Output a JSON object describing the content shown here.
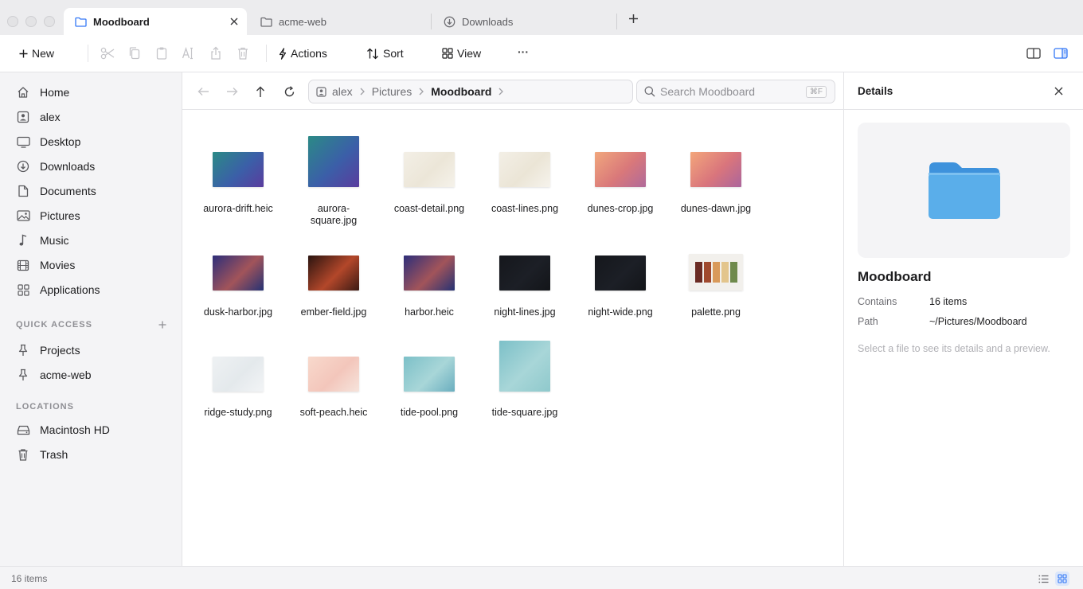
{
  "tabs": [
    {
      "label": "Moodboard",
      "icon": "folder-icon",
      "active": true
    },
    {
      "label": "acme-web",
      "icon": "folder-icon",
      "active": false
    },
    {
      "label": "Downloads",
      "icon": "download-icon",
      "active": false
    }
  ],
  "toolbar": {
    "new_label": "New",
    "actions_label": "Actions",
    "sort_label": "Sort",
    "view_label": "View",
    "more_label": "···"
  },
  "sidebar": {
    "favorites": [
      {
        "label": "Home",
        "icon": "home-icon"
      },
      {
        "label": "alex",
        "icon": "user-icon"
      },
      {
        "label": "Desktop",
        "icon": "desktop-icon"
      },
      {
        "label": "Downloads",
        "icon": "download-icon"
      },
      {
        "label": "Documents",
        "icon": "document-icon"
      },
      {
        "label": "Pictures",
        "icon": "image-icon"
      },
      {
        "label": "Music",
        "icon": "music-icon"
      },
      {
        "label": "Movies",
        "icon": "film-icon"
      },
      {
        "label": "Applications",
        "icon": "apps-icon"
      }
    ],
    "quick_access_heading": "QUICK ACCESS",
    "quick_access": [
      {
        "label": "Projects",
        "icon": "pin-icon"
      },
      {
        "label": "acme-web",
        "icon": "pin-icon"
      }
    ],
    "locations_heading": "LOCATIONS",
    "locations": [
      {
        "label": "Macintosh HD",
        "icon": "drive-icon"
      },
      {
        "label": "Trash",
        "icon": "trash-icon"
      }
    ]
  },
  "breadcrumb": [
    "alex",
    "Pictures",
    "Moodboard"
  ],
  "search": {
    "placeholder": "Search Moodboard",
    "shortcut": "⌘F"
  },
  "files": [
    {
      "name": "aurora-drift.heic",
      "colors": [
        "#2b8a86",
        "#3b5fa8",
        "#5a3c9e"
      ]
    },
    {
      "name": "aurora-square.jpg",
      "colors": [
        "#2b8a86",
        "#3b5fa8",
        "#5a3c9e"
      ]
    },
    {
      "name": "coast-detail.png",
      "colors": [
        "#f3efe6",
        "#ece6d8",
        "#f5f2ea"
      ]
    },
    {
      "name": "coast-lines.png",
      "colors": [
        "#f3efe6",
        "#ebe5d6",
        "#f6f3ec"
      ]
    },
    {
      "name": "dunes-crop.jpg",
      "colors": [
        "#f1a77d",
        "#d9787a",
        "#b06a9a"
      ]
    },
    {
      "name": "dunes-dawn.jpg",
      "colors": [
        "#f3a67b",
        "#d9757c",
        "#ab659c"
      ]
    },
    {
      "name": "dusk-harbor.jpg",
      "colors": [
        "#2d2e7a",
        "#a2545a",
        "#253274"
      ]
    },
    {
      "name": "ember-field.jpg",
      "colors": [
        "#2a1410",
        "#b3472a",
        "#3b1a14"
      ]
    },
    {
      "name": "harbor.heic",
      "colors": [
        "#2d2e7a",
        "#a2545a",
        "#253274"
      ]
    },
    {
      "name": "night-lines.jpg",
      "colors": [
        "#15171c",
        "#1c1f26",
        "#131519"
      ]
    },
    {
      "name": "night-wide.png",
      "colors": [
        "#15171c",
        "#1c1f26",
        "#131519"
      ]
    },
    {
      "name": "palette.png",
      "colors": [
        "#f2f0ec",
        "#f2f0ec",
        "#f2f0ec"
      ]
    },
    {
      "name": "ridge-study.png",
      "colors": [
        "#eef1f3",
        "#e4e9ec",
        "#f2f4f6"
      ]
    },
    {
      "name": "soft-peach.heic",
      "colors": [
        "#f8d9cc",
        "#f3c6bb",
        "#f6e4dc"
      ]
    },
    {
      "name": "tide-pool.png",
      "colors": [
        "#7cc0c8",
        "#a8d6d8",
        "#6aaebf"
      ]
    },
    {
      "name": "tide-square.jpg",
      "colors": [
        "#7cc0c8",
        "#a8d6d8",
        "#8fc9cc"
      ]
    }
  ],
  "palette_swatches": [
    "#6b2c24",
    "#a04a2e",
    "#d99a5a",
    "#e3c58c",
    "#6f8a4c"
  ],
  "details": {
    "title": "Details",
    "name": "Moodboard",
    "contains_label": "Contains",
    "contains_value": "16 items",
    "path_label": "Path",
    "path_value": "~/Pictures/Moodboard",
    "hint": "Select a file to see its details and a preview."
  },
  "status": {
    "item_count": "16 items"
  },
  "colors": {
    "accent": "#3478f6",
    "folder": "#4aa3e8"
  }
}
